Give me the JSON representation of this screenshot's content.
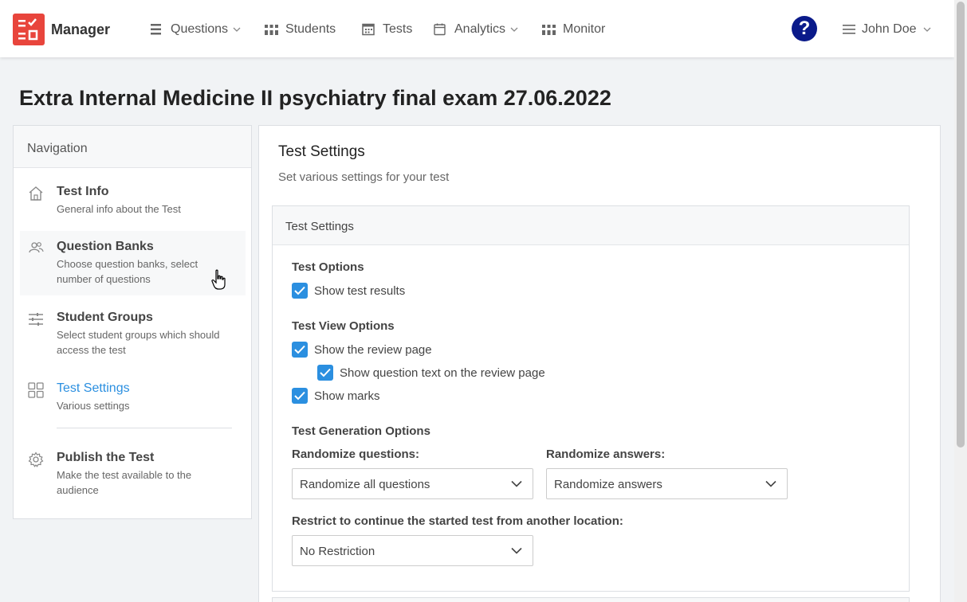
{
  "nav": {
    "brand": "Manager",
    "items": [
      {
        "label": "Questions",
        "icon": "list-icon",
        "dropdown": true
      },
      {
        "label": "Students",
        "icon": "people-icon",
        "dropdown": false
      },
      {
        "label": "Tests",
        "icon": "calendar-grid-icon",
        "dropdown": false
      },
      {
        "label": "Analytics",
        "icon": "calendar-icon",
        "dropdown": true
      },
      {
        "label": "Monitor",
        "icon": "people-icon",
        "dropdown": false
      }
    ],
    "help": "?",
    "user": "John Doe"
  },
  "page": {
    "title": "Extra Internal Medicine II psychiatry final exam 27.06.2022"
  },
  "sidebar": {
    "header": "Navigation",
    "items": [
      {
        "title": "Test Info",
        "desc": "General info about the Test",
        "icon": "home-icon"
      },
      {
        "title": "Question Banks",
        "desc": "Choose question banks, select number of questions",
        "icon": "users-icon"
      },
      {
        "title": "Student Groups",
        "desc": "Select student groups which should access the test",
        "icon": "sliders-icon"
      },
      {
        "title": "Test Settings",
        "desc": "Various settings",
        "icon": "grid-icon",
        "active": true
      },
      {
        "title": "Publish the Test",
        "desc": "Make the test available to the audience",
        "icon": "gear-icon"
      }
    ]
  },
  "main": {
    "title": "Test Settings",
    "subtitle": "Set various settings for your test",
    "card_header": "Test Settings",
    "test_options": {
      "label": "Test Options",
      "show_results": "Show test results"
    },
    "view_options": {
      "label": "Test View Options",
      "review_page": "Show the review page",
      "question_text": "Show question text on the review page",
      "marks": "Show marks"
    },
    "generation": {
      "label": "Test Generation Options",
      "randomize_questions_label": "Randomize questions:",
      "randomize_questions_value": "Randomize all questions",
      "randomize_answers_label": "Randomize answers:",
      "randomize_answers_value": "Randomize answers"
    },
    "restrict": {
      "label": "Restrict to continue the started test from another location:",
      "value": "No Restriction"
    }
  },
  "colors": {
    "accent": "#2b8fe0",
    "logo": "#e8453c",
    "help": "#0a1a8a"
  }
}
